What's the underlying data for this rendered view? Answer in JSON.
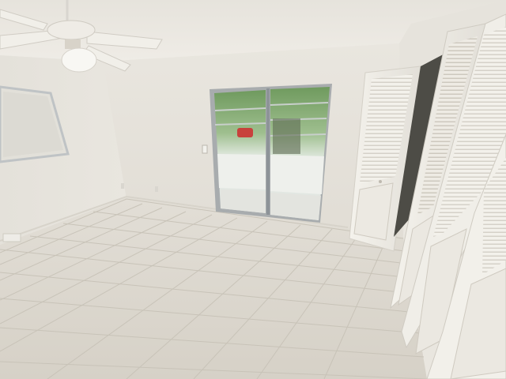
{
  "scene": {
    "kind": "photo",
    "colors": {
      "ceiling": "#ece9e2",
      "wall": "#e8e5de",
      "wall_shadow": "#dcd8cf",
      "floor": "#ddd9d0",
      "grout": "#c9c4b9",
      "trim": "#f1efe9",
      "glass_outside": "#d8e4d8",
      "trees": "#7aa06a",
      "door_frame": "#9aa0a4",
      "closet_gap": "#4a4a44",
      "fan": "#f2f0ea",
      "car": "#c8413c"
    }
  }
}
